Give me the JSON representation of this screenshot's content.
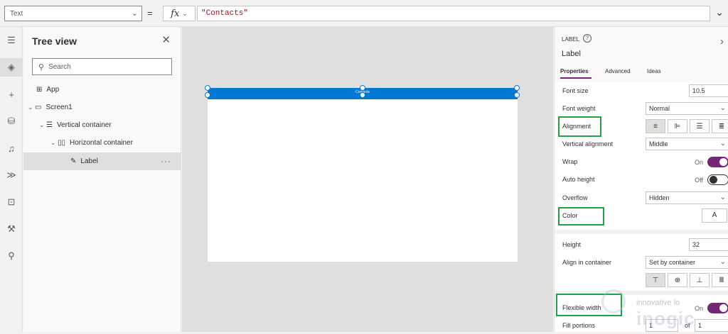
{
  "formula_bar": {
    "property": "Text",
    "equals": "=",
    "fx": "fx",
    "formula": "\"Contacts\""
  },
  "rail_icons": [
    "hamburger-icon",
    "layers-icon",
    "plus-icon",
    "database-icon",
    "media-icon",
    "power-automate-icon",
    "variables-icon",
    "tools-icon",
    "search-icon"
  ],
  "tree_view": {
    "title": "Tree view",
    "search_placeholder": "Search",
    "items": [
      {
        "label": "App"
      },
      {
        "label": "Screen1"
      },
      {
        "label": "Vertical container"
      },
      {
        "label": "Horizontal container"
      },
      {
        "label": "Label",
        "more": "···"
      }
    ]
  },
  "canvas": {
    "label_text": "Contacts",
    "label_color": "#0078d4"
  },
  "properties": {
    "control_kind": "LABEL",
    "help": "?",
    "control_name": "Label",
    "tabs": [
      "Properties",
      "Advanced",
      "Ideas"
    ],
    "font_size_label": "Font size",
    "font_size_value": "10.5",
    "font_weight_label": "Font weight",
    "font_weight_value": "Normal",
    "alignment_label": "Alignment",
    "vertical_alignment_label": "Vertical alignment",
    "vertical_alignment_value": "Middle",
    "wrap_label": "Wrap",
    "wrap_state": "On",
    "auto_height_label": "Auto height",
    "auto_height_state": "Off",
    "overflow_label": "Overflow",
    "overflow_value": "Hidden",
    "color_label": "Color",
    "color_button": "A",
    "height_label": "Height",
    "height_value": "32",
    "align_in_container_label": "Align in container",
    "align_in_container_value": "Set by container",
    "flexible_width_label": "Flexible width",
    "flexible_width_state": "On",
    "fill_portions_label": "Fill portions",
    "fill_portions_value": "1",
    "fill_portions_of": "of",
    "fill_portions_total": "1"
  },
  "watermark": {
    "line1": "innovative lo",
    "line2": "inogic"
  },
  "colors": {
    "accent": "#742774",
    "selection": "#0078d4",
    "highlight_box": "#1fa24a"
  }
}
